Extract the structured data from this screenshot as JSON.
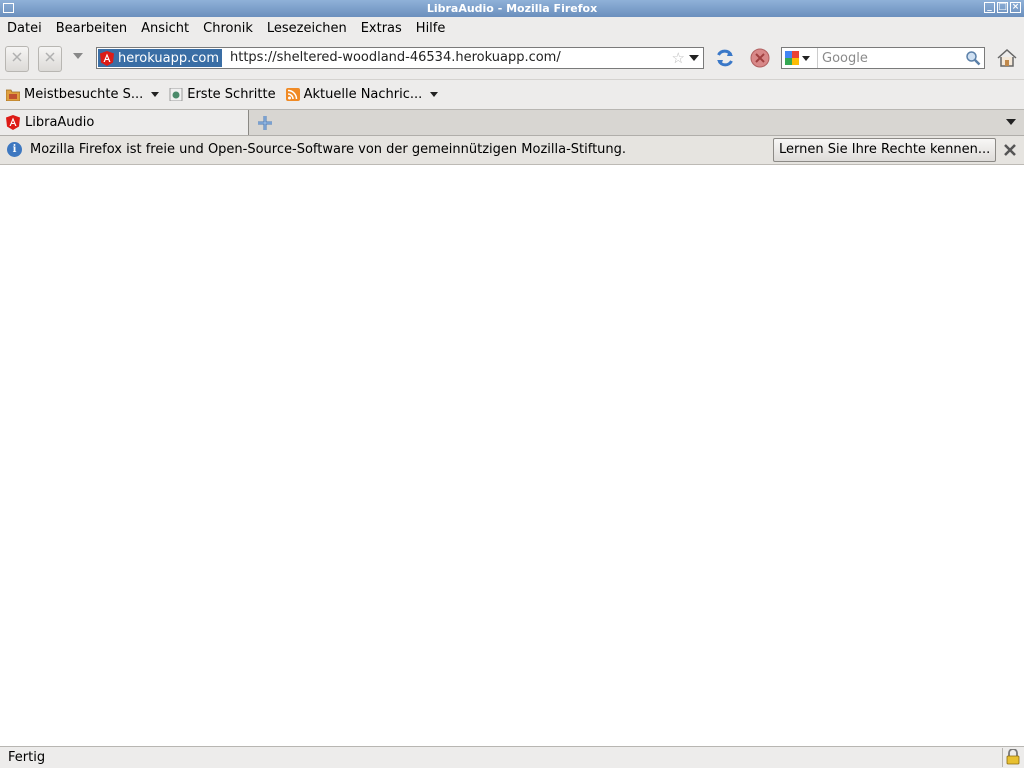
{
  "window": {
    "title": "LibraAudio - Mozilla Firefox"
  },
  "menubar": {
    "items": [
      "Datei",
      "Bearbeiten",
      "Ansicht",
      "Chronik",
      "Lesezeichen",
      "Extras",
      "Hilfe"
    ]
  },
  "navbar": {
    "identity_label": "herokuapp.com",
    "url": "https://sheltered-woodland-46534.herokuapp.com/",
    "search_placeholder": "Google"
  },
  "bookmarks": {
    "items": [
      {
        "label": "Meistbesuchte S...",
        "icon": "folder-icon"
      },
      {
        "label": "Erste Schritte",
        "icon": "page-icon"
      },
      {
        "label": "Aktuelle Nachric...",
        "icon": "rss-icon"
      }
    ]
  },
  "tabs": [
    {
      "label": "LibraAudio",
      "icon": "angular-icon"
    }
  ],
  "notification": {
    "text": "Mozilla Firefox ist freie und Open-Source-Software von der gemeinnützigen Mozilla-Stiftung.",
    "button_label": "Lernen Sie Ihre Rechte kennen..."
  },
  "status": {
    "text": "Fertig"
  },
  "colors": {
    "titlebar": "#7a9cc8",
    "chrome": "#edeceb",
    "identity": "#3a6ea5",
    "angular_red": "#dd1b16",
    "reload_blue": "#3a78c8",
    "stop_red": "#c84040",
    "info_blue": "#3e78c0"
  }
}
